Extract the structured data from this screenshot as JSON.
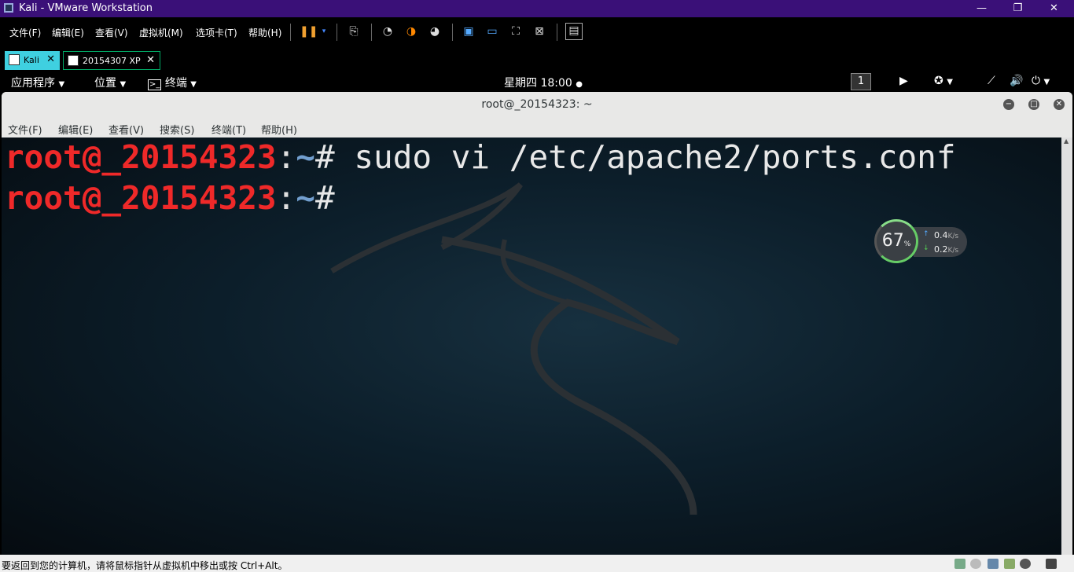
{
  "vmware": {
    "title": "Kali - VMware Workstation",
    "window_controls": {
      "minimize": "—",
      "restore": "❐",
      "close": "✕"
    },
    "menu": [
      "文件(F)",
      "编辑(E)",
      "查看(V)",
      "虚拟机(M)",
      "选项卡(T)",
      "帮助(H)"
    ],
    "tabs": [
      {
        "label": "Kali",
        "active": true
      },
      {
        "label": "20154307 XP",
        "active": false
      }
    ],
    "status_text": "要返回到您的计算机，请将鼠标指针从虚拟机中移出或按 Ctrl+Alt。"
  },
  "gnome_panel": {
    "applications": "应用程序",
    "places": "位置",
    "terminal": "终端",
    "clock": "星期四 18:00",
    "workspace": "1"
  },
  "terminal": {
    "title": "root@_20154323: ~",
    "menu": [
      "文件(F)",
      "编辑(E)",
      "查看(V)",
      "搜索(S)",
      "终端(T)",
      "帮助(H)"
    ],
    "lines": [
      {
        "user": "root@_20154323",
        "sep": ":",
        "path": "~",
        "prompt": "#",
        "command": " sudo vi /etc/apache2/ports.conf"
      },
      {
        "user": "root@_20154323",
        "sep": ":",
        "path": "~",
        "prompt": "#",
        "command": ""
      }
    ]
  },
  "net_widget": {
    "percent": "67",
    "percent_unit": "%",
    "upload": "0.4",
    "download": "0.2",
    "rate_unit": "K/s"
  },
  "colors": {
    "vm_title_bg": "#3a1078",
    "prompt_user": "#ef2929",
    "prompt_path": "#729fcf",
    "active_tab": "#3fd0e0"
  }
}
